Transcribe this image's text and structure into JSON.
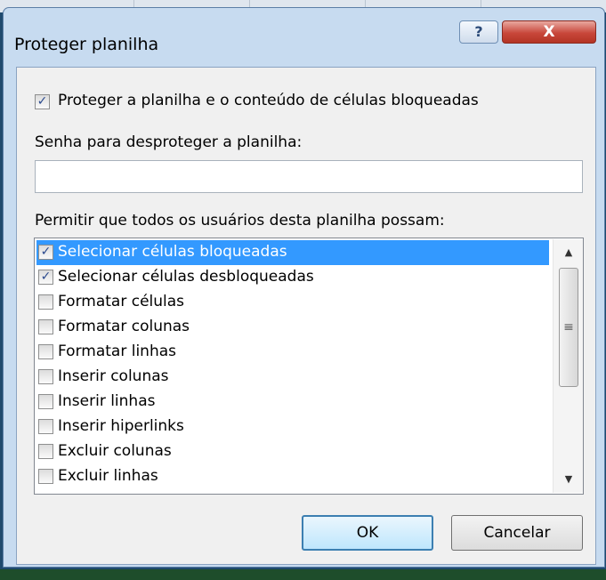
{
  "window": {
    "title": "Proteger planilha",
    "help_glyph": "?",
    "close_glyph": "X"
  },
  "protect": {
    "label": "Proteger a planilha e o conteúdo de células bloqueadas",
    "checked": true
  },
  "password": {
    "label": "Senha para desproteger a planilha:",
    "value": ""
  },
  "permissions": {
    "label": "Permitir que todos os usuários desta planilha possam:",
    "items": [
      {
        "label": "Selecionar células bloqueadas",
        "checked": true,
        "selected": true
      },
      {
        "label": "Selecionar células desbloqueadas",
        "checked": true,
        "selected": false
      },
      {
        "label": "Formatar células",
        "checked": false,
        "selected": false
      },
      {
        "label": "Formatar colunas",
        "checked": false,
        "selected": false
      },
      {
        "label": "Formatar linhas",
        "checked": false,
        "selected": false
      },
      {
        "label": "Inserir colunas",
        "checked": false,
        "selected": false
      },
      {
        "label": "Inserir linhas",
        "checked": false,
        "selected": false
      },
      {
        "label": "Inserir hiperlinks",
        "checked": false,
        "selected": false
      },
      {
        "label": "Excluir colunas",
        "checked": false,
        "selected": false
      },
      {
        "label": "Excluir linhas",
        "checked": false,
        "selected": false
      }
    ]
  },
  "buttons": {
    "ok": "OK",
    "cancel": "Cancelar"
  },
  "icons": {
    "check": "checkmark-icon",
    "scroll_up": "scroll-up-arrow-icon",
    "scroll_down": "scroll-down-arrow-icon",
    "grip": "scroll-grip-icon"
  },
  "colors": {
    "selection": "#3399ff",
    "close_button": "#c8473b",
    "dialog_frame": "#c7dbf0"
  }
}
